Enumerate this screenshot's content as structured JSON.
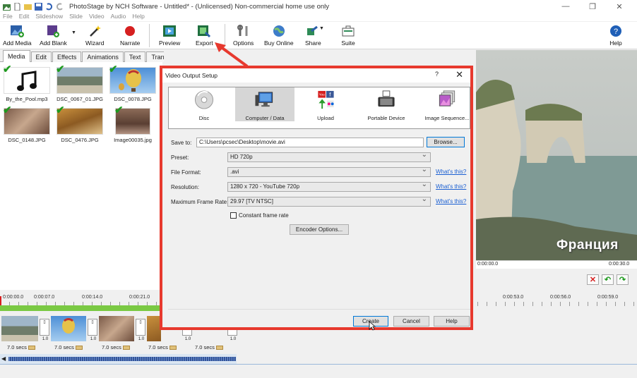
{
  "app": {
    "title": "PhotoStage by NCH Software - Untitled* - (Unlicensed) Non-commercial home use only"
  },
  "menu": [
    "File",
    "Edit",
    "Slideshow",
    "Slide",
    "Video",
    "Audio",
    "Help"
  ],
  "toolbar": {
    "add_media": "Add Media",
    "add_blank": "Add Blank",
    "wizard": "Wizard",
    "narrate": "Narrate",
    "preview": "Preview",
    "export": "Export",
    "options": "Options",
    "buy_online": "Buy Online",
    "share": "Share",
    "suite": "Suite",
    "help": "Help"
  },
  "tabs": [
    "Media",
    "Edit",
    "Effects",
    "Animations",
    "Text",
    "Transitions"
  ],
  "media": [
    {
      "name": "By_the_Pool.mp3"
    },
    {
      "name": "DSC_0067_01.JPG"
    },
    {
      "name": "DSC_0078.JPG"
    },
    {
      "name": "DSC_0148.JPG"
    },
    {
      "name": "DSC_0476.JPG"
    },
    {
      "name": "Image00035.jpg"
    }
  ],
  "preview": {
    "caption": "Франция",
    "time_start": "0:00:00.0",
    "time_end": "0:00:30.0"
  },
  "timeline": {
    "ruler": [
      "0:00:00.0",
      "0:00:07.0",
      "0:00:14.0",
      "0:00:21.0",
      "0:00:53.0",
      "0:00:56.0",
      "0:00:59.0"
    ],
    "durations": [
      "7.0 secs",
      "7.0 secs",
      "7.0 secs",
      "7.0 secs",
      "7.0 secs"
    ],
    "transition_value": "1.0"
  },
  "dialog": {
    "title": "Video Output Setup",
    "help": "?",
    "close": "✕",
    "output_types": [
      "Disc",
      "Computer / Data",
      "Upload",
      "Portable Device",
      "Image Sequence..."
    ],
    "save_to_label": "Save to:",
    "save_to_value": "C:\\Users\\pcsec\\Desktop\\movie.avi",
    "browse": "Browse...",
    "preset_label": "Preset:",
    "preset_value": "HD 720p",
    "file_format_label": "File Format:",
    "file_format_value": ".avi",
    "resolution_label": "Resolution:",
    "resolution_value": "1280 x 720 - YouTube 720p",
    "frame_rate_label": "Maximum Frame Rate:",
    "frame_rate_value": "29.97 [TV NTSC]",
    "whats_this": "What's this?",
    "constant_frame_rate": "Constant frame rate",
    "encoder_options": "Encoder Options...",
    "create": "Create",
    "cancel": "Cancel",
    "help_button": "Help"
  },
  "colors": {
    "highlight": "#e7392e",
    "link": "#1a5fd2",
    "check": "#1e9a1e",
    "timeline_green": "#7ac943"
  }
}
